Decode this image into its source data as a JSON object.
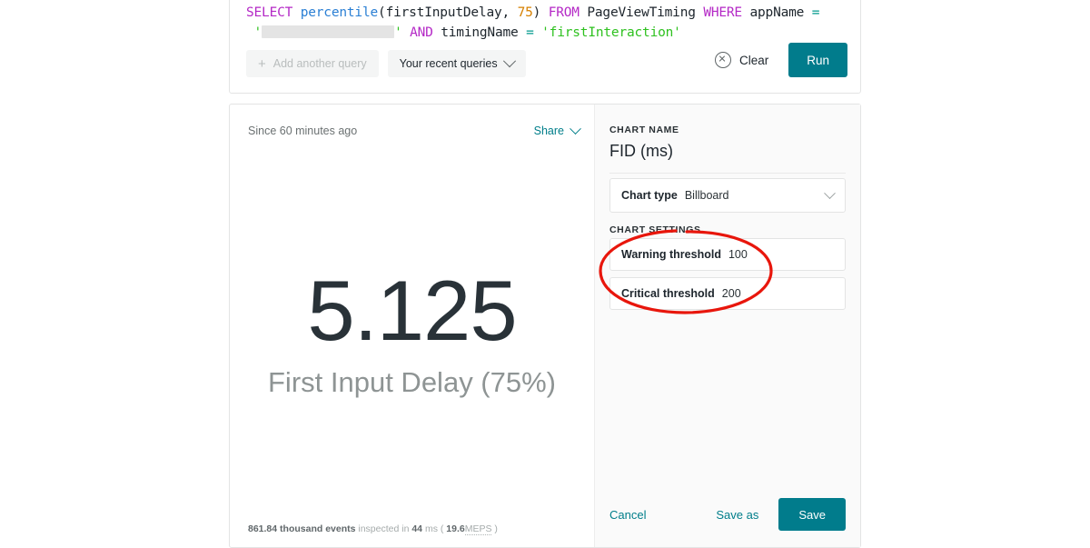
{
  "query_card": {
    "query_tokens": [
      {
        "text": "SELECT",
        "type": "kw"
      },
      {
        "text": " ",
        "type": "punct"
      },
      {
        "text": "percentile",
        "type": "fn"
      },
      {
        "text": "(",
        "type": "punct"
      },
      {
        "text": "firstInputDelay",
        "type": "ident"
      },
      {
        "text": ", ",
        "type": "punct"
      },
      {
        "text": "75",
        "type": "num"
      },
      {
        "text": ")",
        "type": "punct"
      },
      {
        "text": " ",
        "type": "punct"
      },
      {
        "text": "FROM",
        "type": "kw"
      },
      {
        "text": " ",
        "type": "punct"
      },
      {
        "text": "PageViewTiming",
        "type": "tbl"
      },
      {
        "text": " ",
        "type": "punct"
      },
      {
        "text": "WHERE",
        "type": "kw"
      },
      {
        "text": " ",
        "type": "punct"
      },
      {
        "text": "appName",
        "type": "ident"
      },
      {
        "text": " ",
        "type": "punct"
      },
      {
        "text": "=",
        "type": "op"
      },
      {
        "text": "\n ",
        "type": "punct"
      },
      {
        "text": "'",
        "type": "str"
      },
      {
        "text": "",
        "type": "redacted"
      },
      {
        "text": "'",
        "type": "str"
      },
      {
        "text": " ",
        "type": "punct"
      },
      {
        "text": "AND",
        "type": "kw"
      },
      {
        "text": " ",
        "type": "punct"
      },
      {
        "text": "timingName",
        "type": "ident"
      },
      {
        "text": " ",
        "type": "punct"
      },
      {
        "text": "=",
        "type": "op"
      },
      {
        "text": " ",
        "type": "punct"
      },
      {
        "text": "'firstInteraction'",
        "type": "str"
      }
    ],
    "add_query_label": "Add another query",
    "recent_queries_label": "Your recent queries",
    "clear_label": "Clear",
    "run_label": "Run"
  },
  "result_card": {
    "since_label": "Since 60 minutes ago",
    "share_label": "Share",
    "billboard_value": "5.125",
    "billboard_label": "First Input Delay (75%)",
    "footer": {
      "events": "861.84 thousand events",
      "inspected": " inspected in ",
      "duration": "44",
      "duration_unit": " ms ( ",
      "rate": "19.6",
      "rate_unit": "MEPS",
      "close": " )"
    }
  },
  "settings": {
    "chart_name_label": "CHART NAME",
    "chart_name_value": "FID (ms)",
    "chart_type_label": "Chart type",
    "chart_type_value": "Billboard",
    "chart_settings_label": "CHART SETTINGS",
    "warning_threshold_label": "Warning threshold",
    "warning_threshold_value": "100",
    "critical_threshold_label": "Critical threshold",
    "critical_threshold_value": "200",
    "cancel_label": "Cancel",
    "save_as_label": "Save as",
    "save_label": "Save"
  },
  "colors": {
    "accent_teal": "#017c8c",
    "link_teal": "#007e8a",
    "annotation_red": "#e8160c",
    "keyword_purple": "#b429c6",
    "function_blue": "#2a7fd4",
    "string_green": "#2ec11f",
    "number_orange": "#d68000"
  }
}
